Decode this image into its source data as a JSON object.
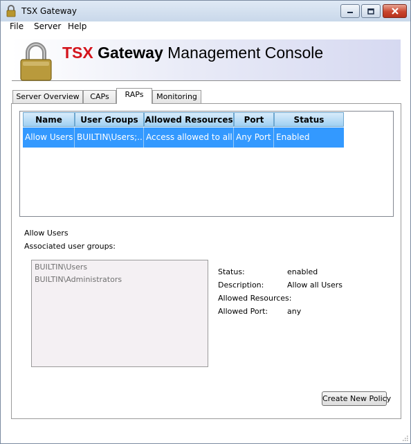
{
  "window": {
    "title": "TSX Gateway"
  },
  "menu": {
    "items": [
      "File",
      "Server",
      "Help"
    ]
  },
  "banner": {
    "title_part1": "TSX",
    "title_part2": "Gateway",
    "title_part3": "Management Console"
  },
  "tabs": [
    {
      "label": "Server Overview",
      "active": false
    },
    {
      "label": "CAPs",
      "active": false
    },
    {
      "label": "RAPs",
      "active": true
    },
    {
      "label": "Monitoring",
      "active": false
    }
  ],
  "table": {
    "columns": [
      "Name",
      "User Groups",
      "Allowed Resources",
      "Port",
      "Status"
    ],
    "rows": [
      [
        "Allow Users",
        "BUILTIN\\Users;...",
        "Access allowed to all ...",
        "Any Port",
        "Enabled"
      ]
    ]
  },
  "details": {
    "selected_name": "Allow Users",
    "groups_label": "Associated user groups:",
    "groups": [
      "BUILTIN\\Users",
      "BUILTIN\\Administrators"
    ],
    "fields": [
      {
        "label": "Status:",
        "value": "enabled"
      },
      {
        "label": "Description:",
        "value": "Allow all Users"
      },
      {
        "label": "Allowed Resources:",
        "value": ""
      },
      {
        "label": "Allowed Port:",
        "value": "any"
      }
    ]
  },
  "actions": {
    "create_label": "Create New Policy"
  },
  "colors": {
    "brand_red": "#d4141c",
    "selection_blue": "#3399ff",
    "header_blue": "#9fd0f2"
  }
}
